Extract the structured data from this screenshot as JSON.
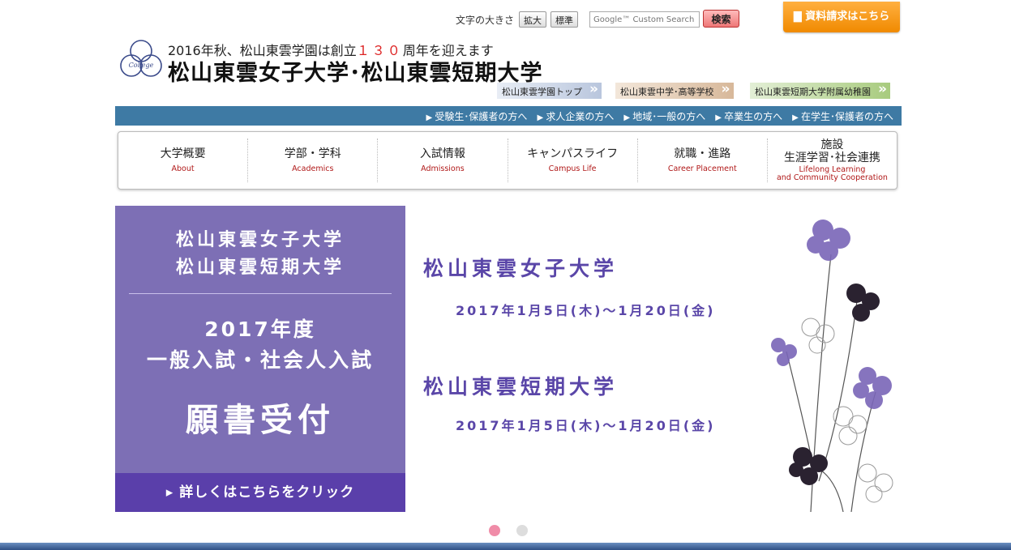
{
  "utility": {
    "font_size_label": "文字の大きさ",
    "enlarge": "拡大",
    "normal": "標準",
    "search_placeholder": "Google™ Custom Search",
    "search_button": "検索",
    "request_button": "資料請求はこちら"
  },
  "header": {
    "anniv_prefix": "2016年秋、松山東雲学園は創立",
    "anniv_number": "１３０",
    "anniv_suffix": "周年を迎えます",
    "univ_name": "松山東雲女子大学･松山東雲短期大学",
    "emblem_text": "College"
  },
  "sublinks": {
    "gakuen": "松山東雲学園トップ",
    "chuko": "松山東雲中学･高等学校",
    "yochien": "松山東雲短期大学附属幼稚園"
  },
  "audience": [
    "受験生･保護者の方へ",
    "求人企業の方へ",
    "地域･一般の方へ",
    "卒業生の方へ",
    "在学生･保護者の方へ"
  ],
  "nav": {
    "about": {
      "jp": "大学概要",
      "en": "About"
    },
    "academics": {
      "jp": "学部・学科",
      "en": "Academics"
    },
    "admissions": {
      "jp": "入試情報",
      "en": "Admissions"
    },
    "campus": {
      "jp": "キャンパスライフ",
      "en": "Campus Life"
    },
    "career": {
      "jp": "就職・進路",
      "en": "Career Placement"
    },
    "lifelong": {
      "jp1": "施設",
      "jp2": "生涯学習･社会連携",
      "en1": "Lifelong Learning",
      "en2": "and Community Cooperation"
    }
  },
  "banner": {
    "left_title_1": "松山東雲女子大学",
    "left_title_2": "松山東雲短期大学",
    "exam_1": "2017年度",
    "exam_2": "一般入試・社会人入試",
    "accept": "願書受付",
    "click": "▸ 詳しくはこちらをクリック",
    "univ_1": "松山東雲女子大学",
    "date_1": "2017年1月5日(木)～1月20日(金)",
    "univ_2": "松山東雲短期大学",
    "date_2": "2017年1月5日(木)～1月20日(金)"
  },
  "colors": {
    "accent_blue": "#3e7aa4",
    "banner_purple": "#7d6fb5",
    "text_purple": "#5a46a8",
    "orange": "#f08a00"
  }
}
